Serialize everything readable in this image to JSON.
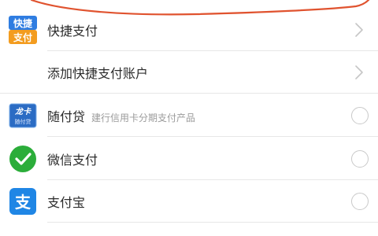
{
  "colors": {
    "scribble": "#e0532f",
    "kuaijie_top": "#2f7de1",
    "kuaijie_bottom": "#f39c1f",
    "wechat": "#2bad3a",
    "alipay": "#1f86e5",
    "longka": "#2b6cc4"
  },
  "rows": [
    {
      "icon": "kuaijie-pay-icon",
      "icon_text_top": "快捷",
      "icon_text_bottom": "支付",
      "label": "快捷支付",
      "trailing": "chevron"
    },
    {
      "label": "添加快捷支付账户",
      "trailing": "chevron"
    },
    {
      "icon": "longka-card-icon",
      "icon_text_top": "龙卡",
      "icon_text_bottom": "随付贷",
      "label": "随付贷",
      "sublabel": "建行信用卡分期支付产品",
      "trailing": "radio"
    },
    {
      "icon": "wechat-pay-icon",
      "label": "微信支付",
      "trailing": "radio"
    },
    {
      "icon": "alipay-icon",
      "icon_text": "支",
      "label": "支付宝",
      "trailing": "radio"
    }
  ]
}
